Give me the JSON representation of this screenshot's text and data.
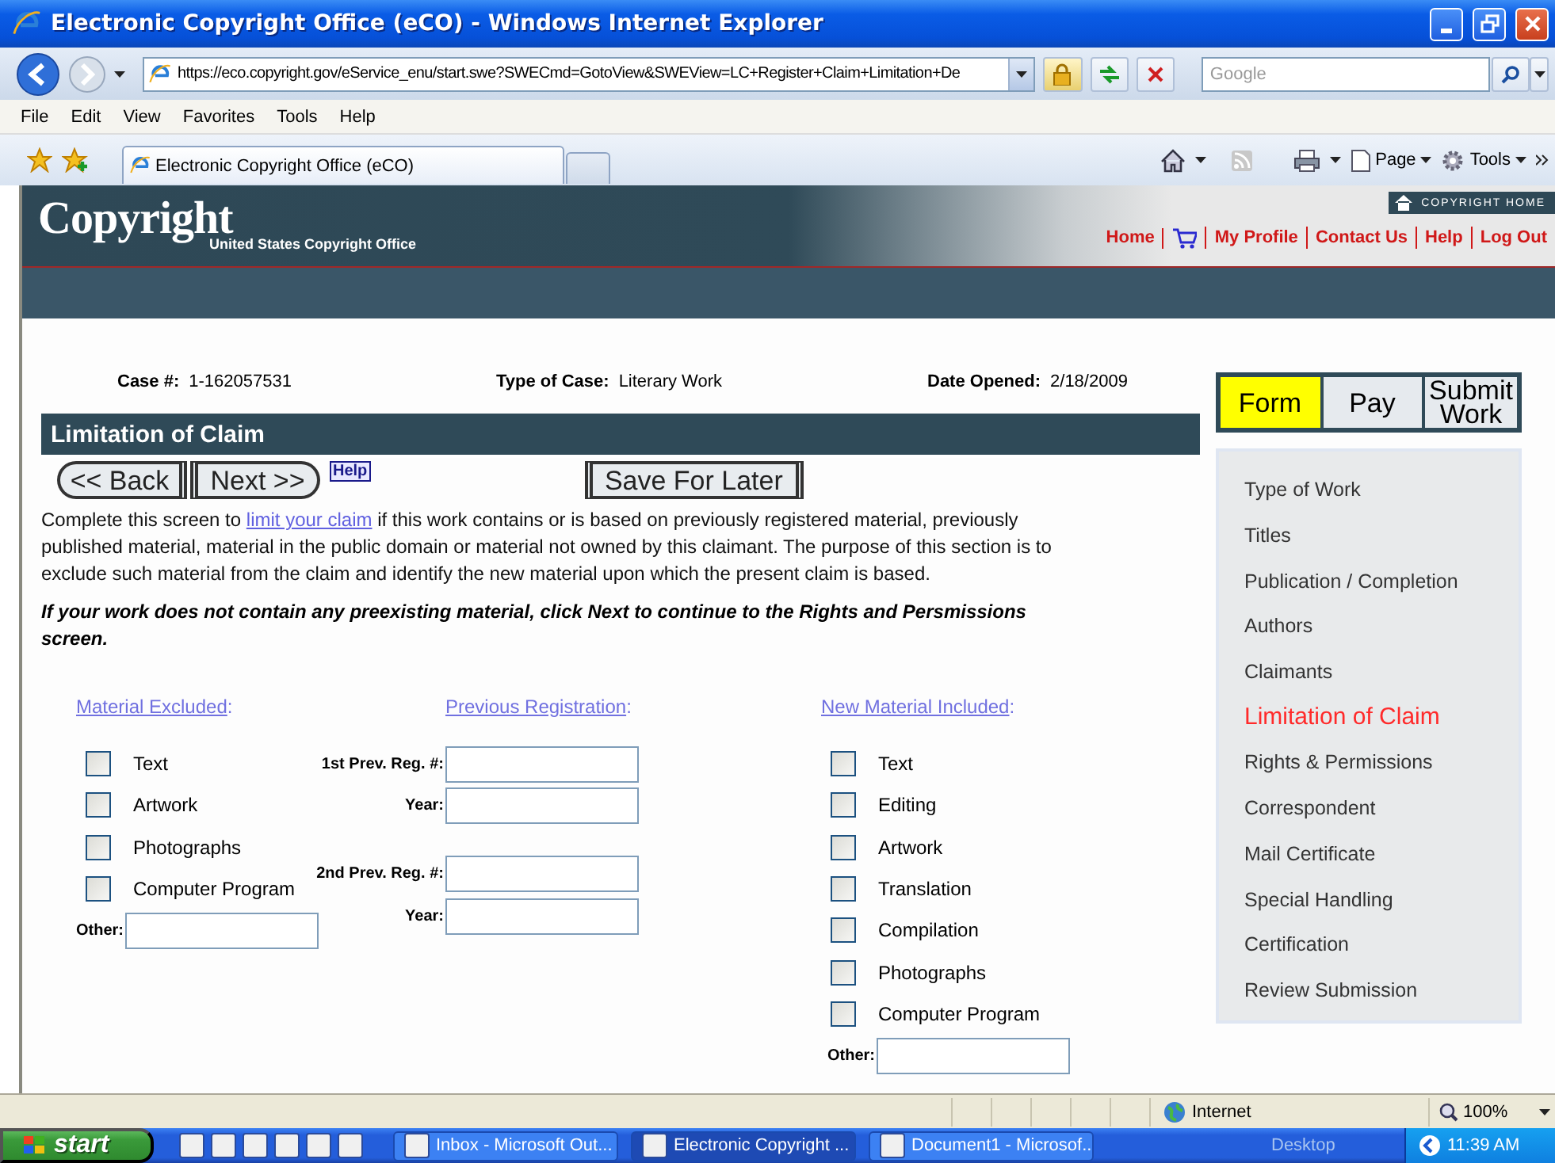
{
  "window": {
    "title": "Electronic Copyright Office (eCO) - Windows Internet Explorer"
  },
  "address_bar": {
    "url": "https://eco.copyright.gov/eService_enu/start.swe?SWECmd=GotoView&SWEView=LC+Register+Claim+Limitation+De"
  },
  "search": {
    "placeholder": "Google"
  },
  "menu": [
    "File",
    "Edit",
    "View",
    "Favorites",
    "Tools",
    "Help"
  ],
  "tabs": [
    {
      "label": "Electronic Copyright Office (eCO)",
      "selected": true
    }
  ],
  "command_bar": [
    "Page",
    "Tools"
  ],
  "site_header": {
    "logo": "Copyright",
    "subtitle": "United States Copyright Office",
    "home_link": "COPYRIGHT HOME",
    "links": [
      {
        "kind": "text",
        "label": "Home"
      },
      {
        "kind": "cart"
      },
      {
        "kind": "text",
        "label": "My Profile"
      },
      {
        "kind": "text",
        "label": "Contact Us"
      },
      {
        "kind": "text",
        "label": "Help"
      },
      {
        "kind": "text",
        "label": "Log Out"
      }
    ]
  },
  "case_info": [
    {
      "label": "Case #:",
      "value": "1-162057531"
    },
    {
      "label": "Type of Case:",
      "value": "Literary Work"
    },
    {
      "label": "Date Opened:",
      "value": "2/18/2009"
    }
  ],
  "section_title": "Limitation of Claim",
  "buttons": {
    "back": "<< Back",
    "next": "Next >>",
    "help": "Help",
    "save": "Save For Later"
  },
  "intro": {
    "before": "Complete this screen to ",
    "link": "limit your claim",
    "after": " if this work contains or is based on previously registered material, previously published material, material in the public domain or material not owned by this claimant. The purpose of this section is to exclude such material from the claim and identify the new material upon which the present claim is based."
  },
  "note": "If your work does not contain any preexisting material, click Next to continue to the Rights and Persmissions screen.",
  "material_excluded": {
    "heading": "Material Excluded",
    "suffix": ":",
    "other_label": "Other:",
    "items": [
      {
        "label": "Text",
        "checked": false
      },
      {
        "label": "Artwork",
        "checked": false
      },
      {
        "label": "Photographs",
        "checked": false
      },
      {
        "label": "Computer Program",
        "checked": false
      }
    ]
  },
  "previous_registration": {
    "heading": "Previous Registration",
    "suffix": ":",
    "fields": [
      {
        "label": "1st Prev. Reg. #:"
      },
      {
        "label": "Year:"
      },
      {
        "label": "2nd Prev. Reg. #:"
      },
      {
        "label": "Year:"
      }
    ]
  },
  "new_material_included": {
    "heading": "New Material Included",
    "suffix": ":",
    "other_label": "Other:",
    "items": [
      {
        "label": "Text",
        "checked": false
      },
      {
        "label": "Editing",
        "checked": false
      },
      {
        "label": "Artwork",
        "checked": false
      },
      {
        "label": "Translation",
        "checked": false
      },
      {
        "label": "Compilation",
        "checked": false
      },
      {
        "label": "Photographs",
        "checked": false
      },
      {
        "label": "Computer Program",
        "checked": false
      }
    ]
  },
  "progress_tabs": [
    {
      "label": "Form",
      "selected": true
    },
    {
      "label": "Pay",
      "selected": false
    },
    {
      "label": "Submit Work",
      "selected": false
    }
  ],
  "sidebar": {
    "items": [
      {
        "label": "Type of Work",
        "selected": false
      },
      {
        "label": "Titles",
        "selected": false
      },
      {
        "label": "Publication / Completion",
        "selected": false
      },
      {
        "label": "Authors",
        "selected": false
      },
      {
        "label": "Claimants",
        "selected": false
      },
      {
        "label": "Limitation of Claim",
        "selected": true
      },
      {
        "label": "Rights & Permissions",
        "selected": false
      },
      {
        "label": "Correspondent",
        "selected": false
      },
      {
        "label": "Mail Certificate",
        "selected": false
      },
      {
        "label": "Special Handling",
        "selected": false
      },
      {
        "label": "Certification",
        "selected": false
      },
      {
        "label": "Review Submission",
        "selected": false
      }
    ]
  },
  "status_bar": {
    "zone": "Internet",
    "zoom": "100%"
  },
  "taskbar": {
    "start": "start",
    "tasks": [
      {
        "label": "Inbox - Microsoft Out...",
        "selected": false
      },
      {
        "label": "Electronic Copyright ...",
        "selected": true
      },
      {
        "label": "Document1 - Microsof...",
        "selected": false
      }
    ],
    "desktop": "Desktop",
    "clock": "11:39 AM"
  }
}
